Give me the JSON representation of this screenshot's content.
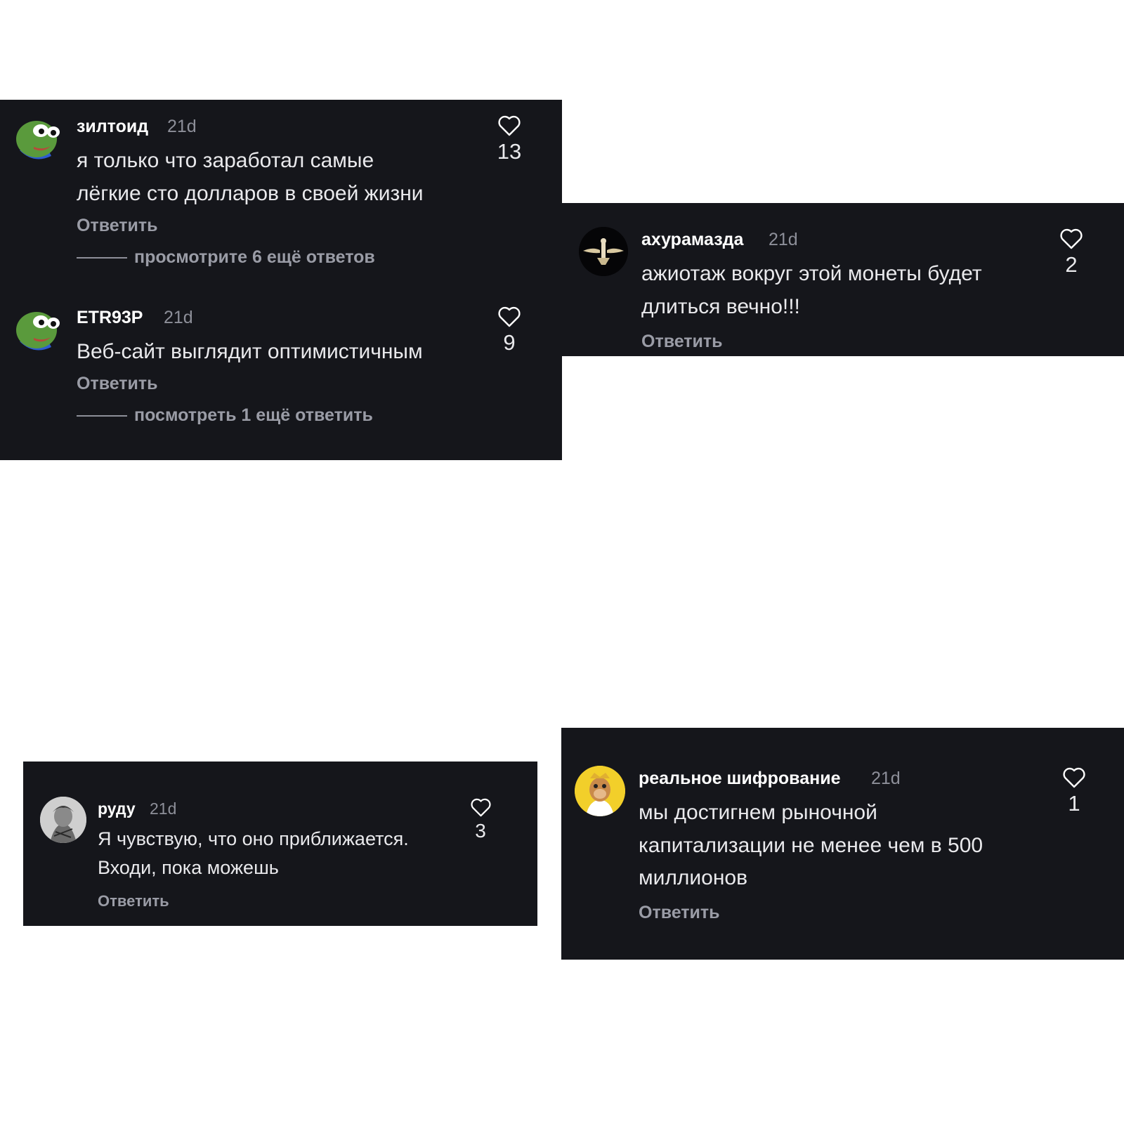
{
  "comments": [
    {
      "username": "зилтоид",
      "time": "21d",
      "text_line1": "я только что заработал самые",
      "text_line2": "лёгкие сто долларов в своей жизни",
      "reply": "Ответить",
      "more_replies": "просмотрите 6 ещё ответов",
      "likes": "13",
      "avatar": "pepe-frog-avatar"
    },
    {
      "username": "ETR93P",
      "time": "21d",
      "text_line1": "Веб-сайт выглядит оптимистичным",
      "reply": "Ответить",
      "more_replies": "посмотреть 1 ещё ответить",
      "likes": "9",
      "avatar": "pepe-frog-avatar"
    },
    {
      "username": "ахурамазда",
      "time": "21d",
      "text_line1": "ажиотаж вокруг этой монеты будет",
      "text_line2": "длиться вечно!!!",
      "reply": "Ответить",
      "likes": "2",
      "avatar": "faravahar-avatar"
    },
    {
      "username": "руду",
      "time": "21d",
      "text_line1": "Я чувствую, что оно приближается.",
      "text_line2": "Входи, пока можешь",
      "reply": "Ответить",
      "likes": "3",
      "avatar": "sketch-portrait-avatar"
    },
    {
      "username": "реальное шифрование",
      "time": "21d",
      "text_line1": "мы достигнем рыночной",
      "text_line2": "капитализации не менее чем в 500",
      "text_line3": "миллионов",
      "reply": "Ответить",
      "likes": "1",
      "avatar": "yellow-ape-avatar"
    }
  ],
  "colors": {
    "panel_bg": "#15161b",
    "username": "#ffffff",
    "meta_text": "#8d8f99",
    "body_text": "#e9e9ec"
  }
}
